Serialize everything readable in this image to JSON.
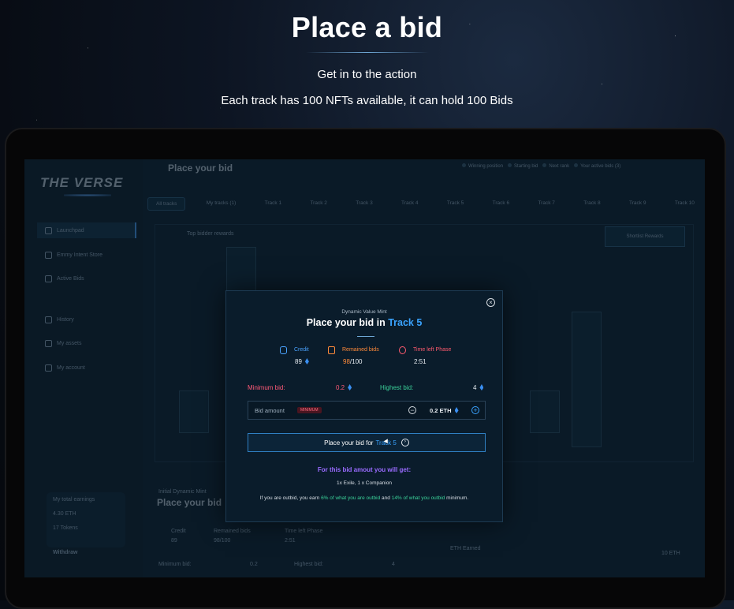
{
  "hero": {
    "title": "Place a bid",
    "subtitle": "Get in to the action",
    "description": "Each track has 100 NFTs available, it can hold 100 Bids"
  },
  "app": {
    "logo": "THE VERSE",
    "page_title": "Place your bid",
    "legend": [
      "Winning position",
      "Starting bid",
      "Next rank",
      "Your active bids (3)"
    ],
    "sidebar": [
      {
        "label": "Launchpad",
        "active": true
      },
      {
        "label": "Emmy Intent Store",
        "active": false
      },
      {
        "label": "Active Bids",
        "active": false
      },
      {
        "label": "History",
        "active": false
      },
      {
        "label": "My assets",
        "active": false
      },
      {
        "label": "My account",
        "active": false
      }
    ],
    "earnings": {
      "title": "My total earnings",
      "eth": "4.30 ETH",
      "tokens": "17 Tokens",
      "withdraw": "Withdraw"
    },
    "tabs": [
      "All tracks",
      "My tracks (1)",
      "Track 1",
      "Track 2",
      "Track 3",
      "Track 4",
      "Track 5",
      "Track 6",
      "Track 7",
      "Track 8",
      "Track 9",
      "Track 10"
    ],
    "filter_left": "Top bidder rewards",
    "filter_right": "Shortlist Rewards",
    "bottom_title": "Place your bid",
    "bottom_kicker": "Initial Dynamic Mint",
    "bottom_labels": {
      "credit": "Credit",
      "credit_val": "89",
      "remained": "Remained bids",
      "remained_val": "98/100",
      "time": "Time left Phase",
      "time_val": "2:51",
      "min": "Minimum bid:",
      "min_val": "0.2",
      "high": "Highest bid:",
      "high_val": "4",
      "eth_earned": "ETH Earned",
      "eth_val": "10 ETH"
    }
  },
  "modal": {
    "kicker": "Dynamic Value Mint",
    "title_prefix": "Place your bid in",
    "title_track": "Track 5",
    "credit_label": "Credit",
    "credit_value": "89",
    "remained_label": "Remained bids",
    "remained_current": "98",
    "remained_total": "/100",
    "time_label": "Time left Phase",
    "time_value": "2:51",
    "min_label": "Minimum bid:",
    "min_value": "0.2",
    "high_label": "Highest bid:",
    "high_value": "4",
    "bid_label": "Bid amount",
    "bid_badge": "MINIMUM",
    "bid_value": "0.2 ETH",
    "cta_prefix": "Place your bid for",
    "cta_track": "Track 5",
    "get_title": "For this bid amout you will get:",
    "get_items": "1x Exile, 1 x Companion",
    "outbid_1": "If you are outbid, you earn ",
    "outbid_2": "6% of what you are outbid",
    "outbid_3": " and ",
    "outbid_4": "14% of what you outbid",
    "outbid_5": " minimum."
  },
  "colors": {
    "accent": "#3aa3ff",
    "credit": "#4aa3ff",
    "remained": "#ff8a3a",
    "time": "#ff5a6e",
    "min": "#ff5a78",
    "high": "#3bd29a",
    "purple": "#9a6bff"
  }
}
